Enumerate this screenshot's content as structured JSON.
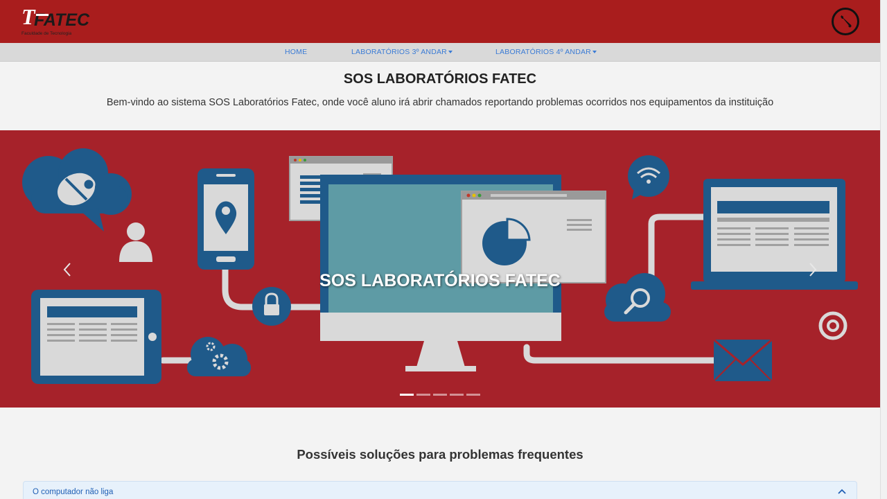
{
  "header": {
    "logo_letter": "T",
    "logo_text": "FATEC",
    "logo_subtitle": "Faculdade de Tecnologia"
  },
  "nav": {
    "items": [
      {
        "label": "HOME"
      },
      {
        "label": "LABORATÓRIOS 3º ANDAR"
      },
      {
        "label": "LABORATÓRIOS 4º ANDAR"
      }
    ]
  },
  "intro": {
    "title": "SOS LABORATÓRIOS FATEC",
    "subtitle": "Bem-vindo ao sistema SOS Laboratórios Fatec, onde você aluno irá abrir chamados reportando problemas ocorridos nos equipamentos da instituição"
  },
  "carousel": {
    "caption": "SOS LABORATÓRIOS FATEC",
    "slide_count": 5,
    "active_index": 0,
    "background": "#a6222a"
  },
  "solutions": {
    "title": "Possíveis soluções para problemas frequentes",
    "items": [
      {
        "label": "O computador não liga"
      }
    ]
  },
  "colors": {
    "brand_red": "#a91d1d",
    "nav_link": "#3a7bd5",
    "illustration_blue": "#1f5a8a",
    "accordion_bg": "#e7f1fb"
  },
  "icons": {
    "header_tool": "wrench-icon",
    "carousel_prev": "chevron-left-icon",
    "carousel_next": "chevron-right-icon",
    "accordion_toggle": "chevron-up-icon"
  }
}
